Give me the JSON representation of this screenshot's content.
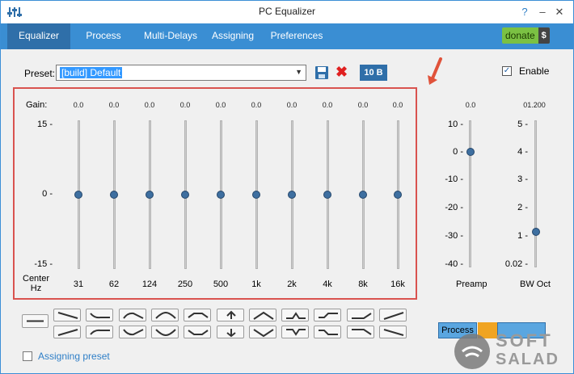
{
  "window": {
    "title": "PC Equalizer"
  },
  "titlebar_buttons": {
    "help": "?",
    "minimize": "–",
    "close": "✕"
  },
  "tabs": [
    "Equalizer",
    "Process",
    "Multi-Delays",
    "Assigning",
    "Preferences"
  ],
  "active_tab": "Equalizer",
  "donate": {
    "label": "donate",
    "symbol": "$"
  },
  "preset": {
    "label": "Preset:",
    "value": "[build] Default"
  },
  "bands_button": "10 B",
  "enable": {
    "label": "Enable",
    "checked": true,
    "mark": "✓"
  },
  "eq": {
    "gain_label": "Gain:",
    "scale": [
      "15 -",
      "0 -",
      "-15 -"
    ],
    "center_label": "Center",
    "hz_label": "Hz",
    "bands": [
      {
        "freq": "31",
        "gain": "0.0"
      },
      {
        "freq": "62",
        "gain": "0.0"
      },
      {
        "freq": "124",
        "gain": "0.0"
      },
      {
        "freq": "250",
        "gain": "0.0"
      },
      {
        "freq": "500",
        "gain": "0.0"
      },
      {
        "freq": "1k",
        "gain": "0.0"
      },
      {
        "freq": "2k",
        "gain": "0.0"
      },
      {
        "freq": "4k",
        "gain": "0.0"
      },
      {
        "freq": "8k",
        "gain": "0.0"
      },
      {
        "freq": "16k",
        "gain": "0.0"
      }
    ]
  },
  "preamp": {
    "value": "0.0",
    "label": "Preamp",
    "scale": [
      "10 -",
      "0 -",
      "-10 -",
      "-20 -",
      "-30 -",
      "-40 -"
    ]
  },
  "bw": {
    "value": "01.200",
    "label": "BW Oct",
    "scale": [
      "5 -",
      "4 -",
      "3 -",
      "2 -",
      "1 -",
      "0.02 -"
    ]
  },
  "assigning_preset": {
    "label": "Assigning preset",
    "checked": false
  },
  "bottom_buttons": {
    "process": "Process"
  },
  "watermark": {
    "line1": "SOFT",
    "line2": "SALAD"
  },
  "colors": {
    "accent": "#3a8ed3",
    "active_tab": "#2f6fa9",
    "donate": "#7bc143",
    "highlight": "#d9534f"
  }
}
